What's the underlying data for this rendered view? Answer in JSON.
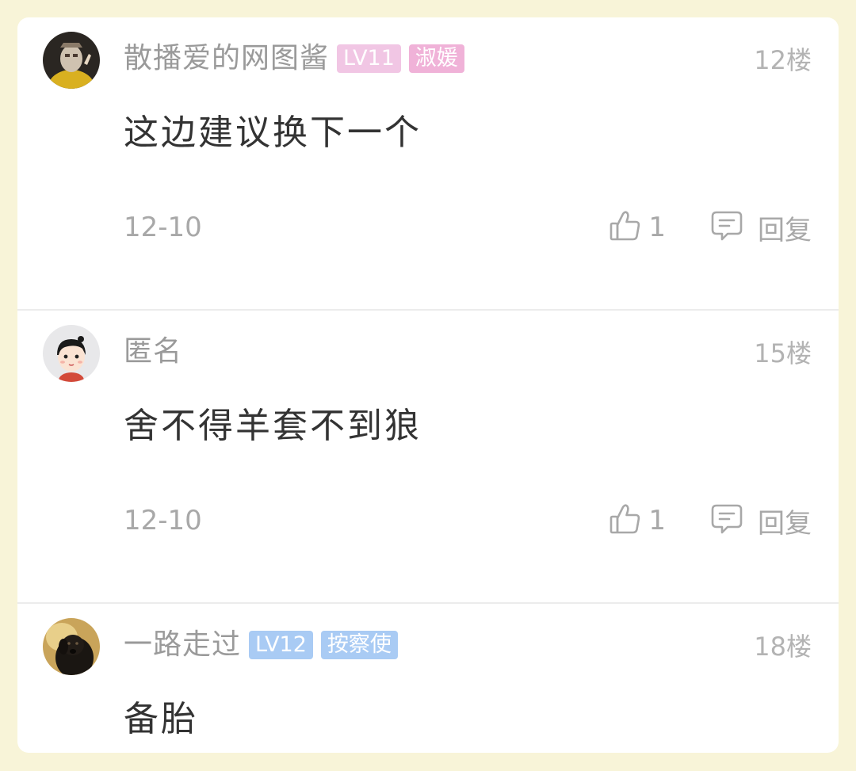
{
  "comments": [
    {
      "username": "散播爱的网图酱",
      "badges": [
        "LV11",
        "淑媛"
      ],
      "floor": "12楼",
      "content": "这边建议换下一个",
      "date": "12-10",
      "likes": "1",
      "reply_label": "回复",
      "avatar_icon": "masked-person-avatar"
    },
    {
      "username": "匿名",
      "badges": [],
      "floor": "15楼",
      "content": "舍不得羊套不到狼",
      "date": "12-10",
      "likes": "1",
      "reply_label": "回复",
      "avatar_icon": "cartoon-girl-avatar"
    },
    {
      "username": "一路走过",
      "badges": [
        "LV12",
        "按察使"
      ],
      "floor": "18楼",
      "content": "备胎",
      "avatar_icon": "black-dog-avatar"
    }
  ],
  "colors": {
    "page_background": "#f8f4d8",
    "badge_pink": "#f1c6e4",
    "badge_blue": "#a9cbf4"
  }
}
